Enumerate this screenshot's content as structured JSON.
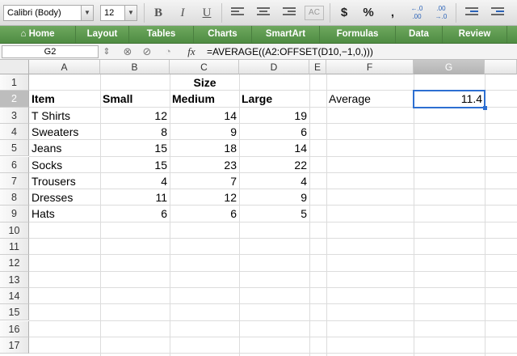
{
  "toolbar": {
    "font_name": "Calibri (Body)",
    "font_size": "12",
    "bold": "B",
    "italic": "I",
    "underline": "U",
    "currency": "$",
    "percent": "%",
    "comma": ",",
    "increase_decimal_top": "←.0",
    "increase_decimal_bottom": ".00",
    "decrease_decimal_top": ".00",
    "decrease_decimal_bottom": "→.0"
  },
  "ribbon": {
    "home_icon": "home-icon",
    "tabs": [
      "Home",
      "Layout",
      "Tables",
      "Charts",
      "SmartArt",
      "Formulas",
      "Data",
      "Review"
    ]
  },
  "formula_bar": {
    "name_box": "G2",
    "fx_label": "fx",
    "formula": "=AVERAGE((A2:OFFSET(D10,−1,0,)))"
  },
  "grid": {
    "columns": [
      "A",
      "B",
      "C",
      "D",
      "E",
      "F",
      "G"
    ],
    "rows": [
      "1",
      "2",
      "3",
      "4",
      "5",
      "6",
      "7",
      "8",
      "9",
      "10",
      "11",
      "12",
      "13",
      "14",
      "15",
      "16",
      "17"
    ],
    "selected_column": "G",
    "selected_row": "2",
    "size_header": "Size",
    "headers": {
      "item": "Item",
      "small": "Small",
      "medium": "Medium",
      "large": "Large"
    },
    "data": [
      {
        "item": "T Shirts",
        "small": "12",
        "medium": "14",
        "large": "19"
      },
      {
        "item": "Sweaters",
        "small": "8",
        "medium": "9",
        "large": "6"
      },
      {
        "item": "Jeans",
        "small": "15",
        "medium": "18",
        "large": "14"
      },
      {
        "item": "Socks",
        "small": "15",
        "medium": "23",
        "large": "22"
      },
      {
        "item": "Trousers",
        "small": "4",
        "medium": "7",
        "large": "4"
      },
      {
        "item": "Dresses",
        "small": "11",
        "medium": "12",
        "large": "9"
      },
      {
        "item": "Hats",
        "small": "6",
        "medium": "6",
        "large": "5"
      }
    ],
    "average_label": "Average",
    "average_value": "11.4"
  },
  "colors": {
    "ribbon_green": "#5a9a4c",
    "selection_blue": "#2d6fd1"
  }
}
